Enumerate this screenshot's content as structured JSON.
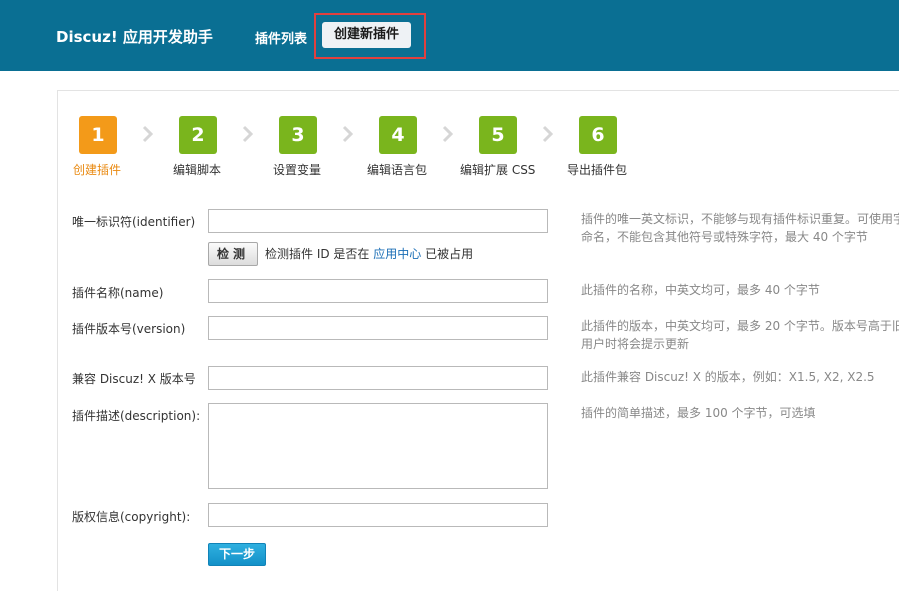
{
  "header": {
    "brand": "Discuz! 应用开发助手",
    "nav_list": "插件列表",
    "nav_create": "创建新插件"
  },
  "steps": [
    {
      "num": "1",
      "label": "创建插件",
      "color": "#f39a19",
      "active": true
    },
    {
      "num": "2",
      "label": "编辑脚本",
      "color": "#7ab51d"
    },
    {
      "num": "3",
      "label": "设置变量",
      "color": "#7ab51d"
    },
    {
      "num": "4",
      "label": "编辑语言包",
      "color": "#7ab51d"
    },
    {
      "num": "5",
      "label": "编辑扩展 CSS",
      "color": "#7ab51d"
    },
    {
      "num": "6",
      "label": "导出插件包",
      "color": "#7ab51d"
    }
  ],
  "form": {
    "identifier": {
      "label": "唯一标识符(identifier)",
      "value": "",
      "hint_line1": "插件的唯一英文标识，不能够与现有插件标识重复。可使用字",
      "hint_line2": "命名，不能包含其他符号或特殊字符，最大 40 个字节"
    },
    "check_button": "检测",
    "check_text_before": "检测插件 ID 是否在",
    "check_link": "应用中心",
    "check_text_after": "已被占用",
    "name": {
      "label": "插件名称(name)",
      "value": "",
      "hint": "此插件的名称，中英文均可，最多 40 个字节"
    },
    "version": {
      "label": "插件版本号(version)",
      "value": "",
      "hint_line1": "此插件的版本，中英文均可，最多 20 个字节。版本号高于旧",
      "hint_line2": "用户时将会提示更新"
    },
    "compat": {
      "label": "兼容 Discuz! X 版本号",
      "value": "",
      "hint": "此插件兼容 Discuz! X 的版本，例如：X1.5, X2, X2.5"
    },
    "description": {
      "label": "插件描述(description):",
      "value": "",
      "hint": "插件的简单描述，最多 100 个字节，可选填"
    },
    "copyright": {
      "label": "版权信息(copyright):",
      "value": ""
    },
    "next_button": "下一步"
  }
}
